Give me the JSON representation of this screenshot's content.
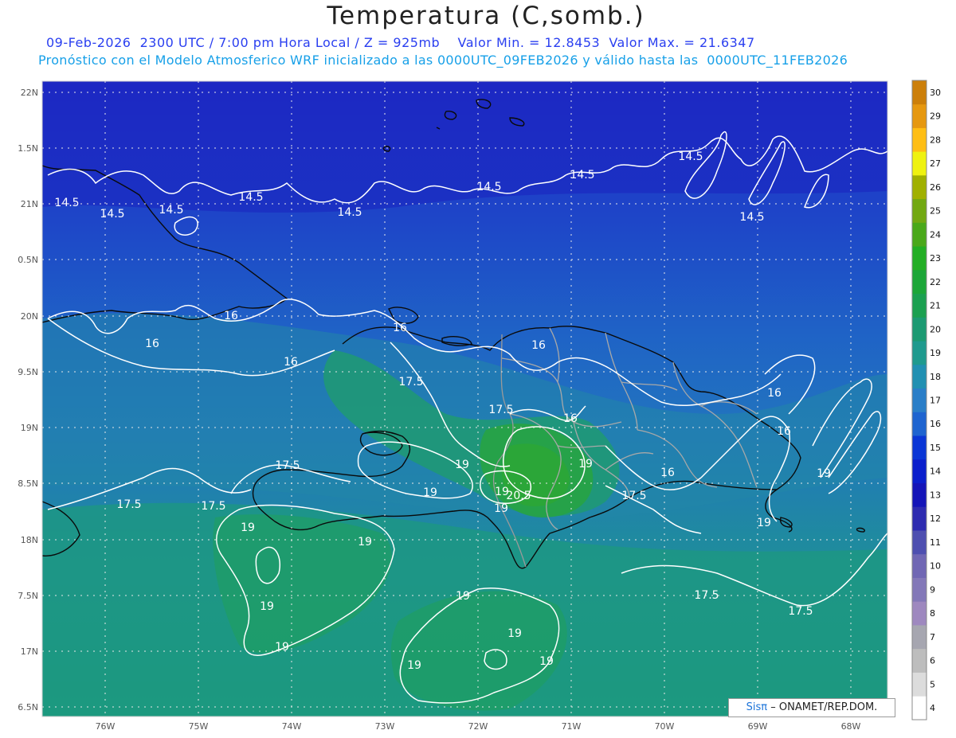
{
  "header": {
    "title": "Temperatura (C,somb.)",
    "line1": {
      "datetime": "09-Feb-2026  2300 UTC / 7:00 pm Hora Local / Z = 925mb",
      "min": "Valor Min. = 12.8453",
      "max": "Valor Max. = 21.6347"
    },
    "line2": "Pronóstico con el Modelo Atmosferico WRF inicializado a las 0000UTC_09FEB2026 y válido hasta las  0000UTC_11FEB2026"
  },
  "axes": {
    "lat_labels": [
      "22N",
      "1.5N",
      "21N",
      "0.5N",
      "20N",
      "9.5N",
      "19N",
      "8.5N",
      "18N",
      "7.5N",
      "17N",
      "6.5N"
    ],
    "lon_labels": [
      "76W",
      "75W",
      "74W",
      "73W",
      "72W",
      "71W",
      "70W",
      "69W",
      "68W"
    ]
  },
  "colorbar": {
    "levels": [
      "4",
      "5",
      "6",
      "7",
      "8",
      "9",
      "10",
      "11",
      "12",
      "13",
      "14",
      "15",
      "16",
      "17",
      "18",
      "19",
      "20",
      "21",
      "22",
      "23",
      "24",
      "25",
      "26",
      "27",
      "28",
      "29",
      "30"
    ],
    "colors": [
      "#ffffff",
      "#dcdcdc",
      "#bdbdbd",
      "#a6a6b0",
      "#9e88bf",
      "#8378b8",
      "#7067b4",
      "#4e4fb0",
      "#2e2bb0",
      "#1414b8",
      "#0a1ecc",
      "#0a36d6",
      "#1e64d0",
      "#2a7ec8",
      "#2190b2",
      "#1f9a8e",
      "#1c9a72",
      "#1ba050",
      "#1ca638",
      "#23ae24",
      "#4aa81a",
      "#72a812",
      "#a0b000",
      "#eff210",
      "#ffbe14",
      "#e69810",
      "#cc7f0a"
    ]
  },
  "contours": {
    "labels": [
      "14.5",
      "14.5",
      "14.5",
      "14.5",
      "14.5",
      "14.5",
      "14.5",
      "14.5",
      "14.5",
      "16",
      "16",
      "16",
      "16",
      "16",
      "16",
      "16",
      "16",
      "16",
      "17.5",
      "17.5",
      "17.5",
      "17.5",
      "17.5",
      "17.5",
      "17.5",
      "17.5",
      "19",
      "19",
      "19",
      "19",
      "19",
      "19",
      "19",
      "19",
      "19",
      "19",
      "20.5"
    ]
  },
  "credit": {
    "sis": "Sisπ",
    "org": "– ONAMET/REP.DOM."
  }
}
